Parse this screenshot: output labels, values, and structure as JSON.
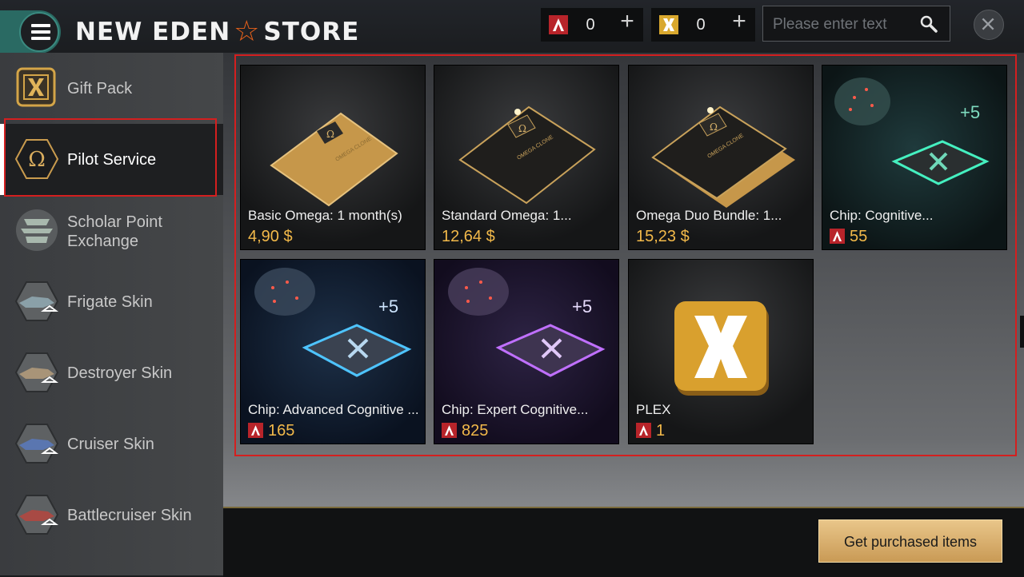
{
  "header": {
    "title_left": "NEW EDEN",
    "title_right": "STORE",
    "currencies": [
      {
        "icon": "aurum-icon",
        "value": "0"
      },
      {
        "icon": "plex-icon",
        "value": "0"
      }
    ],
    "search_placeholder": "Please enter text"
  },
  "sidebar": {
    "items": [
      {
        "label": "Gift Pack",
        "icon": "gift-pack-icon"
      },
      {
        "label": "Pilot Service",
        "icon": "omega-icon",
        "active": true
      },
      {
        "label": "Scholar Point Exchange",
        "icon": "scholar-icon"
      },
      {
        "label": "Frigate Skin",
        "icon": "frigate-icon"
      },
      {
        "label": "Destroyer Skin",
        "icon": "destroyer-icon"
      },
      {
        "label": "Cruiser Skin",
        "icon": "cruiser-icon"
      },
      {
        "label": "Battlecruiser Skin",
        "icon": "battlecruiser-icon"
      }
    ]
  },
  "products": [
    {
      "name": "Basic Omega: 1 month(s)",
      "price": "4,90 $",
      "art_text": "OMEGA CLONE"
    },
    {
      "name": "Standard Omega: 1...",
      "price": "12,64 $",
      "art_text": "OMEGA CLONE"
    },
    {
      "name": "Omega Duo Bundle: 1...",
      "price": "15,23 $",
      "art_text": "OMEGA CLONE"
    },
    {
      "name": "Chip: Cognitive...",
      "price": "55",
      "badge": "+5"
    },
    {
      "name": "Chip: Advanced Cognitive ...",
      "price": "165",
      "badge": "+5"
    },
    {
      "name": "Chip: Expert Cognitive...",
      "price": "825",
      "badge": "+5"
    },
    {
      "name": "PLEX",
      "price": "1"
    }
  ],
  "footer": {
    "get_purchased_label": "Get purchased items"
  },
  "colors": {
    "accent_teal": "#2a6a63",
    "price_gold": "#f2b94a",
    "highlight_red": "#d41f1f"
  }
}
